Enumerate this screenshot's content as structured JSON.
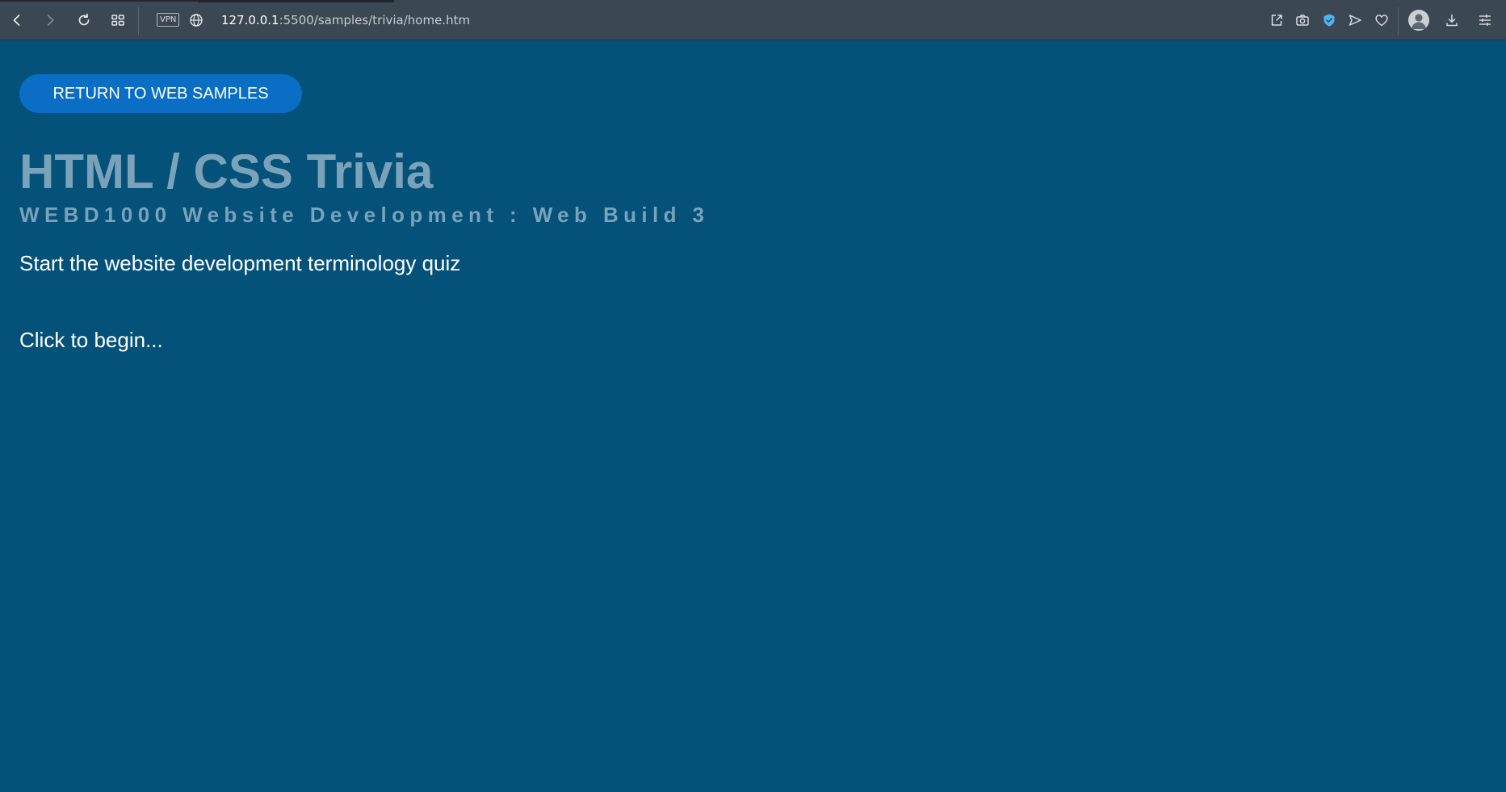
{
  "browser": {
    "nav": {
      "back_icon": "chevron-left-icon",
      "forward_icon": "chevron-right-icon",
      "reload_icon": "reload-icon",
      "tabs_icon": "grid-icon"
    },
    "vpn_label": "VPN",
    "address": {
      "host": "127.0.0.1",
      "path": ":5500/samples/trivia/home.htm"
    },
    "right_icons": [
      "share-icon",
      "camera-icon",
      "shield-icon",
      "send-icon",
      "heart-icon",
      "avatar",
      "download-icon",
      "menu-icon"
    ],
    "colors": {
      "toolbar": "#3b4752",
      "shield": "#4fb3f6"
    }
  },
  "page": {
    "return_button": "RETURN TO WEB SAMPLES",
    "title": "HTML / CSS Trivia",
    "subtitle": "WEBD1000 Website Development : Web Build 3",
    "intro": "Start the website development terminology quiz",
    "begin": "Click to begin...",
    "colors": {
      "background": "#04517a",
      "button": "#0a6ec4",
      "heading": "#7aa2b9",
      "text": "#ffffff"
    }
  }
}
